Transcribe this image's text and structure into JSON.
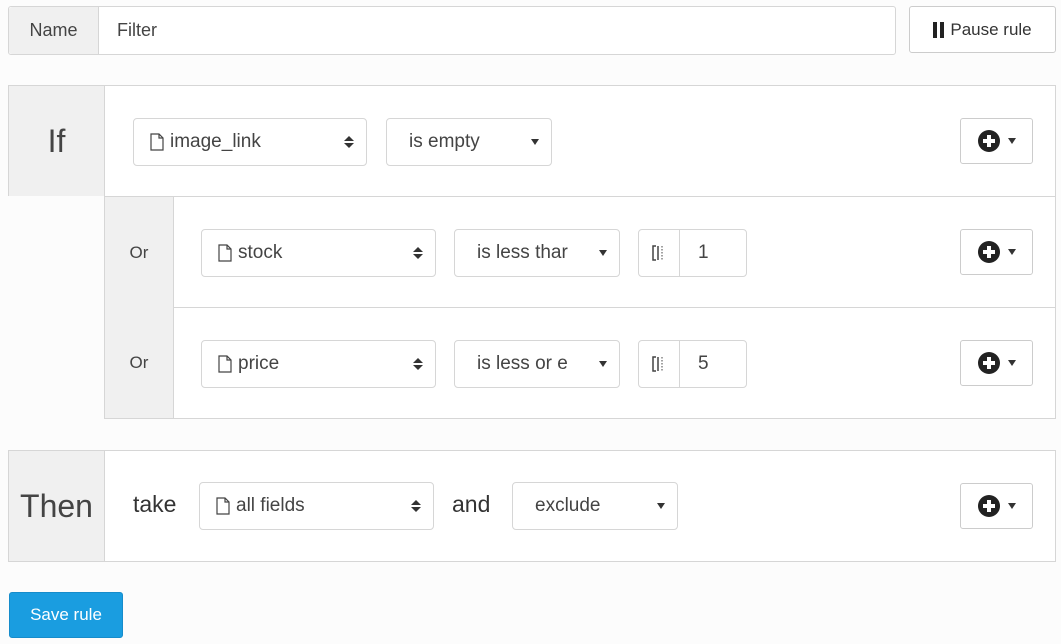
{
  "name_row": {
    "label": "Name",
    "value": "Filter"
  },
  "pause_button": {
    "label": "Pause rule",
    "icon": "pause-icon"
  },
  "if_section": {
    "label": "If",
    "condition": {
      "field": "image_link",
      "operator": "is empty"
    }
  },
  "or_conditions": [
    {
      "label": "Or",
      "field": "stock",
      "operator": "is less thar",
      "value": "1"
    },
    {
      "label": "Or",
      "field": "price",
      "operator": "is less or e",
      "value": "5"
    }
  ],
  "then_section": {
    "label": "Then",
    "take_word": "take",
    "field": "all fields",
    "and_word": "and",
    "action": "exclude"
  },
  "add_button": {
    "icon": "plus-circle-icon"
  },
  "save_button": {
    "label": "Save rule",
    "color": "#1a9de0"
  }
}
